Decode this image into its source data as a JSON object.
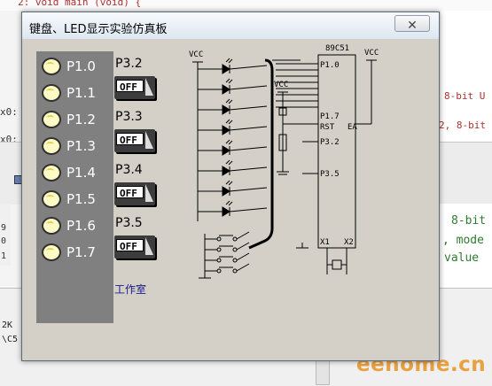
{
  "window": {
    "title": "键盘、LED显示实验仿真板",
    "close_icon": "close-icon"
  },
  "keys": [
    {
      "label": "P1.0"
    },
    {
      "label": "P1.1"
    },
    {
      "label": "P1.2"
    },
    {
      "label": "P1.3"
    },
    {
      "label": "P1.4"
    },
    {
      "label": "P1.5"
    },
    {
      "label": "P1.6"
    },
    {
      "label": "P1.7"
    }
  ],
  "switches": [
    {
      "label": "P3.2",
      "state": "OFF"
    },
    {
      "label": "P3.3",
      "state": "OFF"
    },
    {
      "label": "P3.4",
      "state": "OFF"
    },
    {
      "label": "P3.5",
      "state": "OFF"
    }
  ],
  "studio_label": "工作室",
  "schematic": {
    "chip": "89C51",
    "vcc_left": "VCC",
    "vcc_right": "VCC",
    "vcc_mid": "VCC",
    "pins": [
      "P1.0",
      "P1.7",
      "RST",
      "EA",
      "P3.2",
      "P3.5",
      "X1",
      "X2"
    ]
  },
  "background": {
    "top_code": "2: void main (void) {",
    "right_comments": [
      "8-bit U",
      "2, 8-bit"
    ],
    "left_frags": [
      "x0:",
      "x0:"
    ],
    "green_frags": [
      "8-bit",
      ", mode",
      "value"
    ],
    "row_numbers": [
      "9",
      "0",
      "1"
    ],
    "bottom_lines": [
      "2K",
      "\\C5"
    ],
    "watermark": "eehome.cn"
  }
}
